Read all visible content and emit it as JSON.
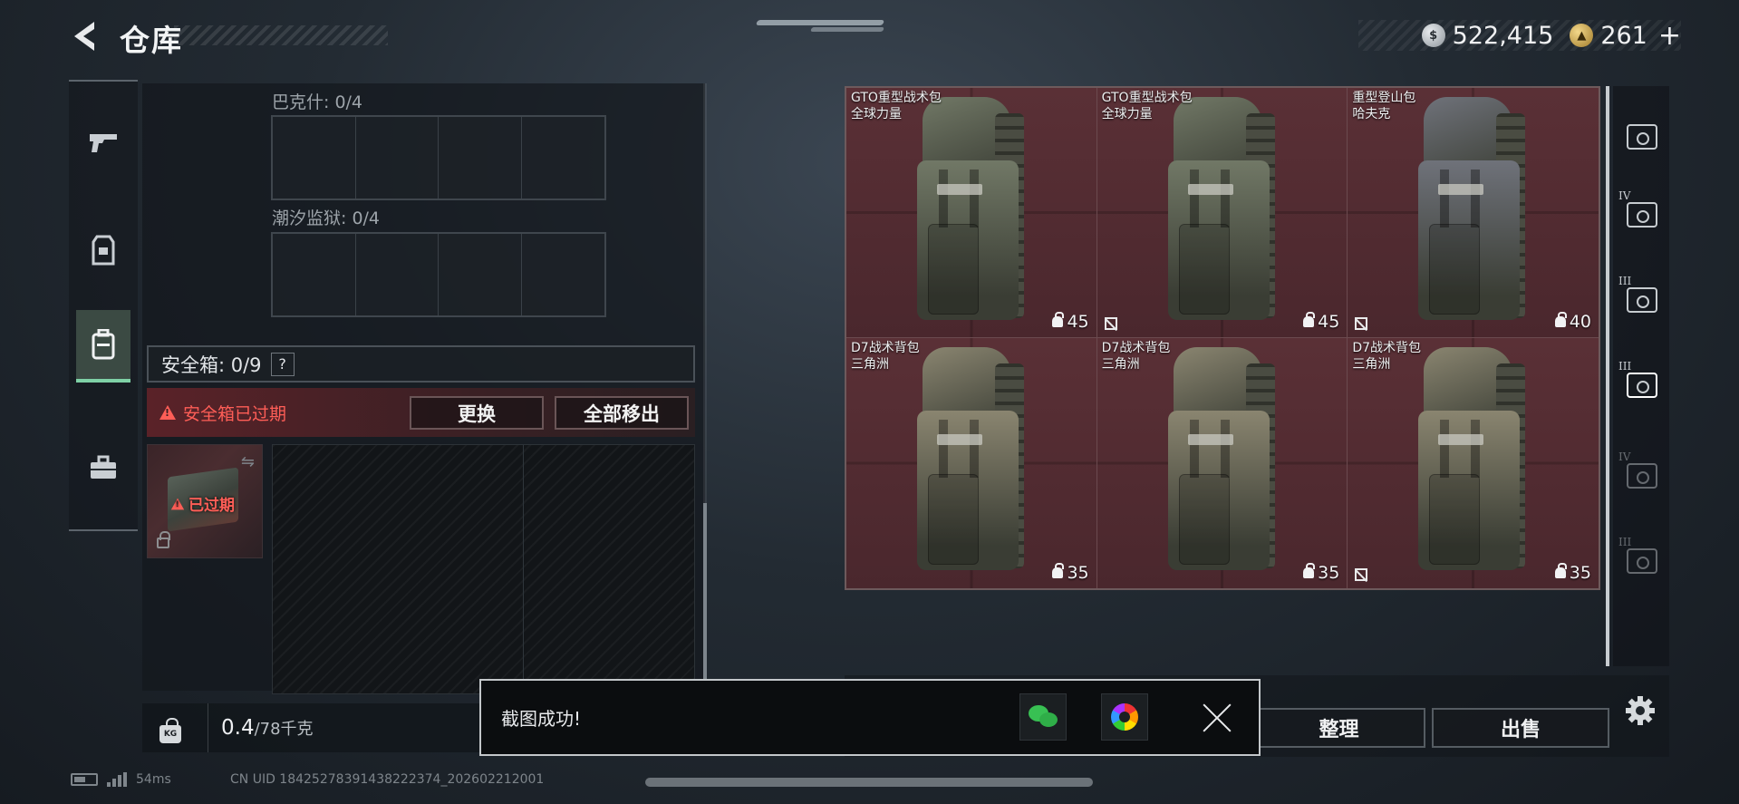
{
  "header": {
    "title": "仓库",
    "currency": [
      {
        "icon": "silver-coin-icon",
        "value": "522,415"
      },
      {
        "icon": "gold-coin-icon",
        "value": "261"
      }
    ],
    "plus": "+"
  },
  "left_rail": {
    "items": [
      {
        "name": "weapons",
        "icon": "pistol-icon",
        "active": false
      },
      {
        "name": "armor",
        "icon": "vest-icon",
        "active": false
      },
      {
        "name": "containers",
        "icon": "backpack-icon",
        "active": true
      },
      {
        "name": "supplies",
        "icon": "toolbox-icon",
        "active": false
      }
    ]
  },
  "storage": {
    "sections": [
      {
        "label": "巴克什: 0/4"
      },
      {
        "label": "潮汐监狱: 0/4"
      }
    ]
  },
  "safe_box": {
    "title": "安全箱: 0/9",
    "help": "?",
    "expired_msg": "安全箱已过期",
    "replace_btn": "更换",
    "move_all_btn": "全部移出",
    "item_tag": "已过期"
  },
  "weight": {
    "icon_label": "KG",
    "current": "0.4",
    "max": "/78千克"
  },
  "inventory": {
    "items": [
      {
        "name": "GTO重型战术包",
        "sub": "全球力量",
        "capacity": "45",
        "no_sale": false,
        "color": "#717866"
      },
      {
        "name": "GTO重型战术包",
        "sub": "全球力量",
        "capacity": "45",
        "no_sale": true,
        "color": "#717866"
      },
      {
        "name": "重型登山包",
        "sub": "哈夫克",
        "capacity": "40",
        "no_sale": true,
        "color": "#6f727a"
      },
      {
        "name": "D7战术背包",
        "sub": "三角洲",
        "capacity": "35",
        "no_sale": false,
        "color": "#8a8570"
      },
      {
        "name": "D7战术背包",
        "sub": "三角洲",
        "capacity": "35",
        "no_sale": false,
        "color": "#8a8570"
      },
      {
        "name": "D7战术背包",
        "sub": "三角洲",
        "capacity": "35",
        "no_sale": true,
        "color": "#8a8570"
      }
    ]
  },
  "right_rail": {
    "items": [
      {
        "roman": "",
        "icon": "helmet-slot-icon"
      },
      {
        "roman": "IV",
        "icon": "case-slot-icon"
      },
      {
        "roman": "III",
        "icon": "case-slot-icon"
      },
      {
        "roman": "III",
        "icon": "container-slot-icon"
      },
      {
        "roman": "IV",
        "icon": "case-slot-icon"
      },
      {
        "roman": "III",
        "icon": "container-slot-icon"
      }
    ]
  },
  "bottom": {
    "sort_btn": "整理",
    "sell_btn": "出售"
  },
  "toast": {
    "message": "截图成功!"
  },
  "status": {
    "ping": "54ms",
    "uid": "CN UID 18425278391438222374_202602212001"
  }
}
